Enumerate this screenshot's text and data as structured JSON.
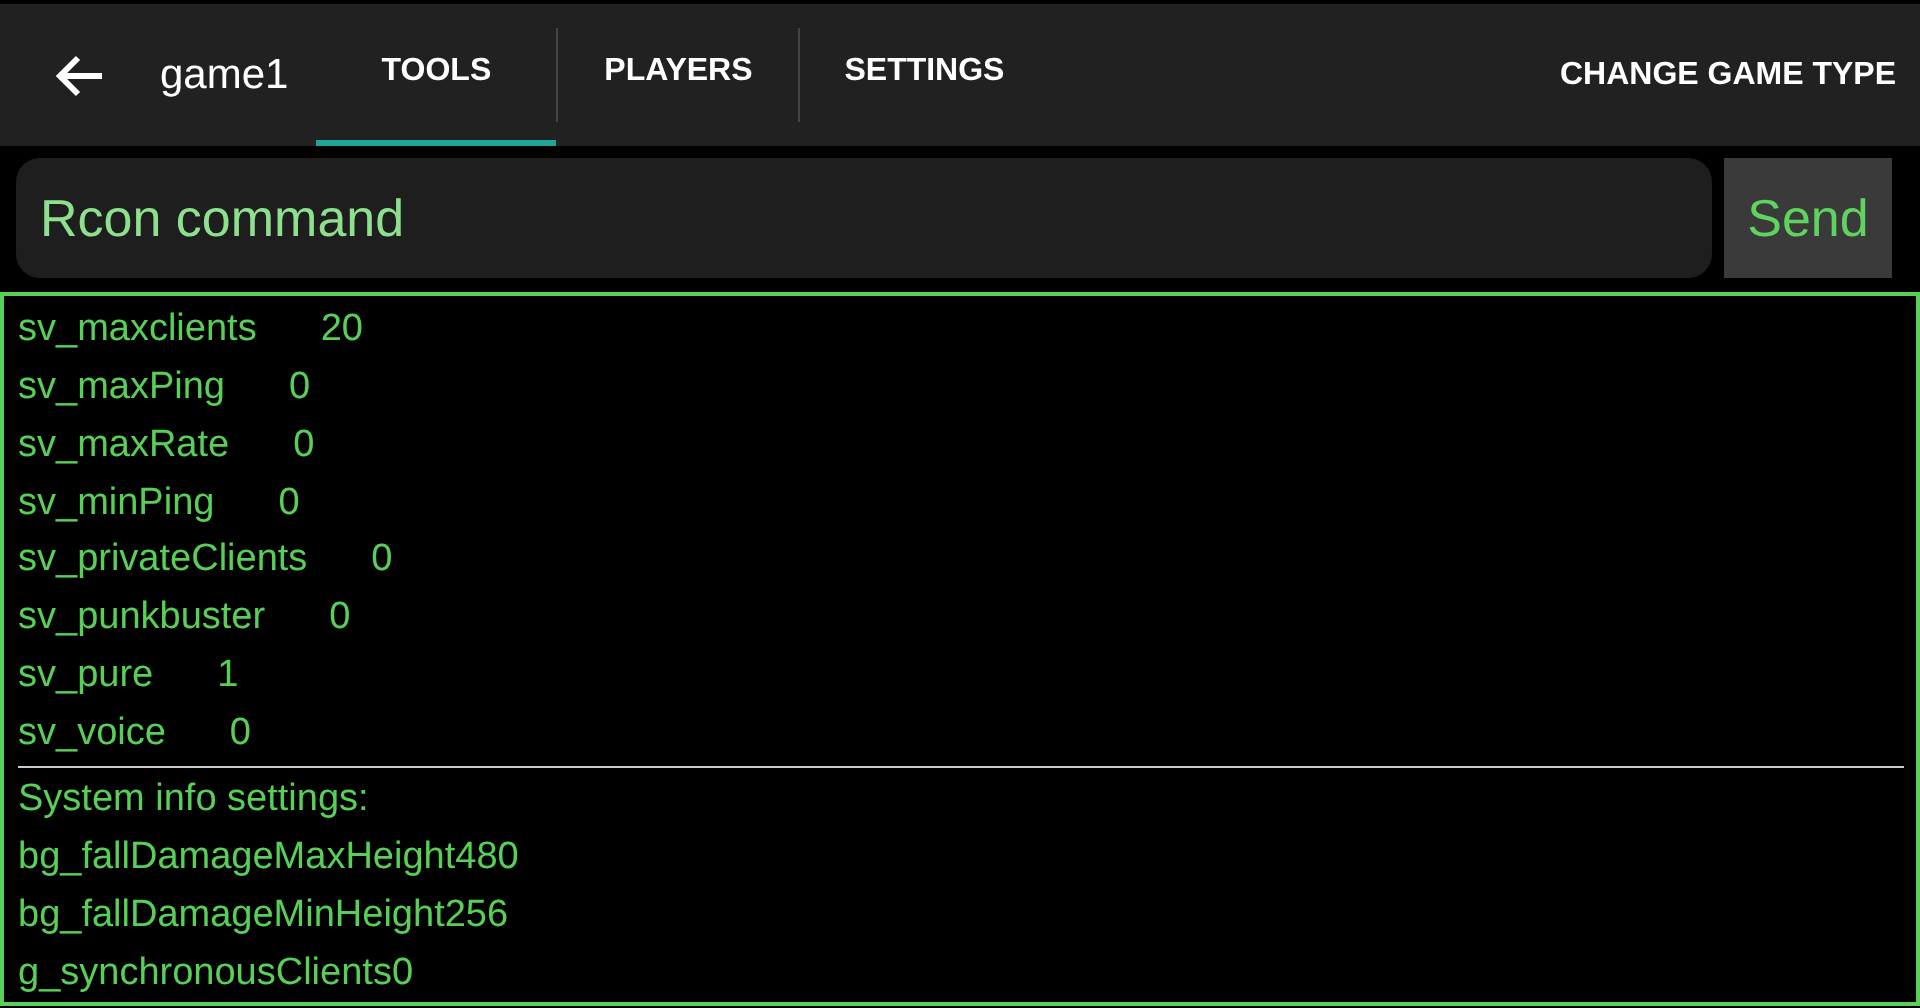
{
  "toolbar": {
    "title": "game1",
    "tabs": [
      {
        "label": "TOOLS",
        "selected": true
      },
      {
        "label": "PLAYERS",
        "selected": false
      },
      {
        "label": "SETTINGS",
        "selected": false
      }
    ],
    "action": "CHANGE GAME TYPE"
  },
  "command": {
    "placeholder": "Rcon command",
    "button": "Send"
  },
  "console": {
    "settings": [
      {
        "name": "sv_maxclients",
        "value": "20"
      },
      {
        "name": "sv_maxPing",
        "value": "0"
      },
      {
        "name": "sv_maxRate",
        "value": "0"
      },
      {
        "name": "sv_minPing",
        "value": "0"
      },
      {
        "name": "sv_privateClients",
        "value": "0"
      },
      {
        "name": "sv_punkbuster",
        "value": "0"
      },
      {
        "name": "sv_pure",
        "value": "1"
      },
      {
        "name": "sv_voice",
        "value": "0"
      }
    ],
    "section_title": "System info settings:",
    "info_lines": [
      "bg_fallDamageMaxHeight480",
      "bg_fallDamageMinHeight256",
      "g_synchronousClients0"
    ]
  }
}
